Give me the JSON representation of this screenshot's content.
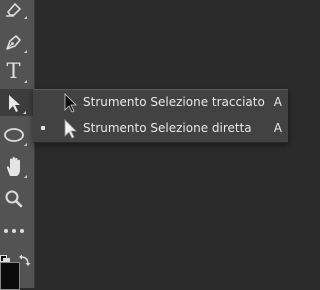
{
  "toolbar": {
    "tools": [
      {
        "name": "pen-tool",
        "icon": "pen-icon",
        "active": false
      },
      {
        "name": "type-tool",
        "icon": "type-icon",
        "label": "T",
        "active": false
      },
      {
        "name": "path-selection-tool",
        "icon": "path-selection-arrow-icon",
        "active": true
      },
      {
        "name": "ellipse-tool",
        "icon": "ellipse-icon",
        "active": false
      },
      {
        "name": "hand-tool",
        "icon": "hand-icon",
        "active": false
      },
      {
        "name": "zoom-tool",
        "icon": "magnifier-icon",
        "active": false
      },
      {
        "name": "more-tools",
        "icon": "more-dots-icon",
        "active": false
      }
    ]
  },
  "submenu": {
    "items": [
      {
        "label": "Strumento Selezione tracciato",
        "shortcut": "A",
        "icon": "black-arrow-icon",
        "selected": false
      },
      {
        "label": "Strumento Selezione diretta",
        "shortcut": "A",
        "icon": "white-arrow-icon",
        "selected": true
      }
    ]
  },
  "colors": {
    "toolbar_bg": "#535353",
    "menu_bg": "#424242",
    "canvas_bg": "#2b2b2b",
    "text": "#e8e8e8"
  }
}
